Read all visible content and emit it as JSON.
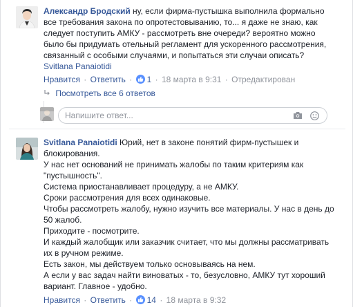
{
  "colors": {
    "link": "#365899",
    "text": "#1d2129",
    "meta": "#90949c",
    "like_badge": "#5890ff",
    "border": "#ccd0d5"
  },
  "comment1": {
    "author": "Александр Бродский",
    "text_lines": [
      " ну, если фирма-пустышка выполнила формально",
      "все требования закона по опротестовыванию, то... я даже не знаю, как",
      "следует поступить АМКУ - рассмотреть вне очереди? вероятно можно",
      "было бы придумать отельный регламент для ускоренного рассмотрения,",
      "связанный с особыми случаями, и попытаться эти случаи описать?"
    ],
    "mention": "Svitlana Panaiotidi",
    "like_label": "Нравится",
    "reply_label": "Ответить",
    "likes_count": "1",
    "timestamp": "18 марта в 9:31",
    "edited": "Отредактирован",
    "view_replies": "Посмотреть все 6 ответов",
    "reply_placeholder": "Напишите ответ..."
  },
  "comment2": {
    "author": "Svitlana Panaiotidi",
    "lines": [
      " Юрий, нет в законе понятий фирм-пустышек и",
      "блокирования.",
      "У нас нет оснований не принимать жалобы по таким критериям как",
      "\"пустышность\".",
      "Система приостанавливает процедуру, а не АМКУ.",
      "Сроки рассмотрения для всех одинаковые.",
      "Чтобы рассмотреть жалобу, нужно изучить все материалы. У нас в день до",
      "50 жалоб.",
      "Приходите - посмотрите.",
      "И каждый жалобщик или заказчик считает, что мы должны рассматривать",
      "их в ручном режиме.",
      "Есть закон, мы действуем только основываясь на нем.",
      "А если у вас задач найти виноватых - то, безусловно, АМКУ тут хороший",
      "вариант. Главное - удобно."
    ],
    "like_label": "Нравится",
    "reply_label": "Ответить",
    "likes_count": "14",
    "timestamp": "18 марта в 9:32"
  }
}
